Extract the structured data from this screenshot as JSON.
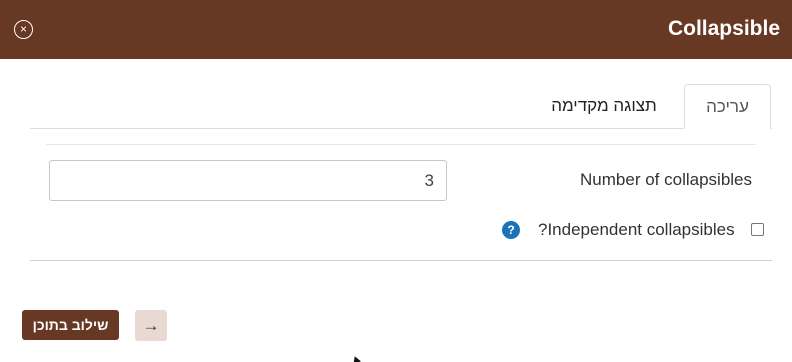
{
  "header": {
    "title": "Collapsible",
    "close_icon": "×"
  },
  "tabs": [
    {
      "label": "עריכה",
      "active": true
    },
    {
      "label": "תצוגה מקדימה",
      "active": false
    }
  ],
  "form": {
    "number_label": "Number of collapsibles",
    "number_value": "3",
    "independent_label": "?Independent collapsibles",
    "independent_checked": false,
    "help_icon": "?"
  },
  "footer": {
    "insert_label": "שילוב בתוכן",
    "arrow_icon": "→"
  },
  "colors": {
    "brand": "#673824",
    "help": "#1a73b8",
    "secondary_button": "#ead9d2"
  }
}
